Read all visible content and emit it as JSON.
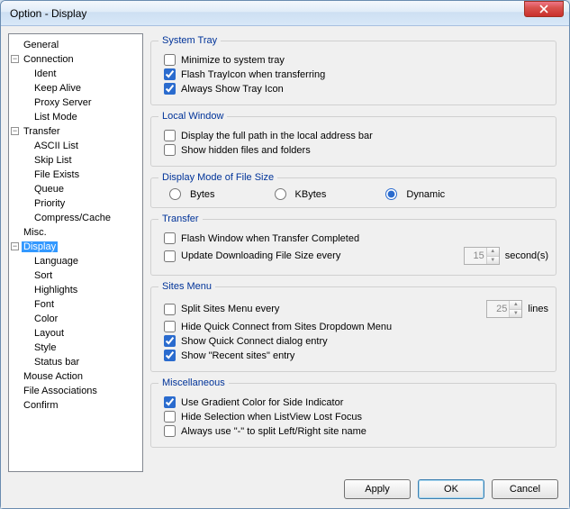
{
  "window": {
    "title": "Option - Display"
  },
  "tree": {
    "general": "General",
    "connection": "Connection",
    "connection_children": {
      "ident": "Ident",
      "keep_alive": "Keep Alive",
      "proxy_server": "Proxy Server",
      "list_mode": "List Mode"
    },
    "transfer": "Transfer",
    "transfer_children": {
      "ascii_list": "ASCII List",
      "skip_list": "Skip List",
      "file_exists": "File Exists",
      "queue": "Queue",
      "priority": "Priority",
      "compress_cache": "Compress/Cache"
    },
    "misc": "Misc.",
    "display": "Display",
    "display_children": {
      "language": "Language",
      "sort": "Sort",
      "highlights": "Highlights",
      "font": "Font",
      "color": "Color",
      "layout": "Layout",
      "style": "Style",
      "status_bar": "Status bar"
    },
    "mouse_action": "Mouse Action",
    "file_associations": "File Associations",
    "confirm": "Confirm"
  },
  "groups": {
    "system_tray": {
      "legend": "System Tray",
      "minimize": "Minimize to system tray",
      "flash": "Flash TrayIcon when transferring",
      "always_show": "Always Show Tray Icon"
    },
    "local_window": {
      "legend": "Local Window",
      "full_path": "Display the full path in the local address bar",
      "hidden": "Show hidden files and folders"
    },
    "file_size": {
      "legend": "Display Mode of File Size",
      "bytes": "Bytes",
      "kbytes": "KBytes",
      "dynamic": "Dynamic"
    },
    "transfer": {
      "legend": "Transfer",
      "flash_window": "Flash Window when Transfer Completed",
      "update_size": "Update Downloading File Size every",
      "update_value": "15",
      "seconds": "second(s)"
    },
    "sites_menu": {
      "legend": "Sites Menu",
      "split_every": "Split Sites Menu every",
      "split_value": "25",
      "lines": "lines",
      "hide_quick": "Hide Quick Connect from Sites Dropdown Menu",
      "show_quick": "Show Quick Connect dialog entry",
      "show_recent": "Show \"Recent sites\" entry"
    },
    "misc": {
      "legend": "Miscellaneous",
      "gradient": "Use Gradient Color for Side Indicator",
      "hide_sel": "Hide Selection when ListView Lost Focus",
      "dash_split": "Always use \"-\" to split Left/Right site name"
    }
  },
  "buttons": {
    "apply": "Apply",
    "ok": "OK",
    "cancel": "Cancel"
  }
}
